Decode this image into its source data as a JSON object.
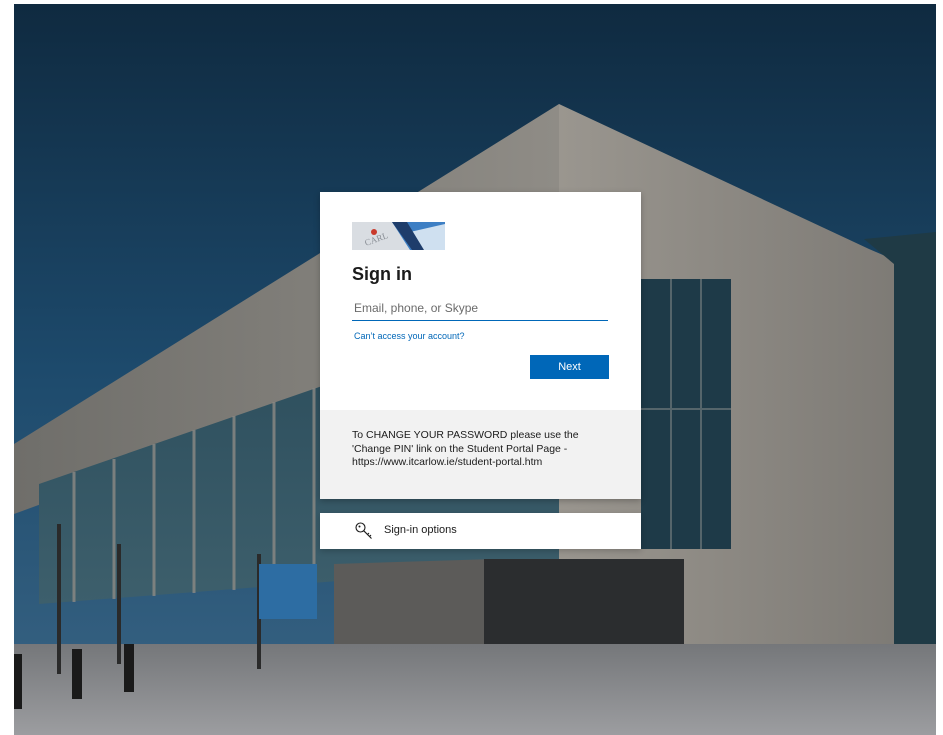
{
  "colors": {
    "accent": "#0067b8",
    "card_bg": "#ffffff",
    "notice_bg": "#f2f2f2",
    "text": "#1b1b1b"
  },
  "background": {
    "icon": "campus-building-photo"
  },
  "card": {
    "logo_icon": "itcarlow-logo",
    "title": "Sign in",
    "email_placeholder": "Email, phone, or Skype",
    "email_value": "",
    "cant_access_link": "Can’t access your account?",
    "next_label": "Next"
  },
  "notice": {
    "line1": "To CHANGE YOUR PASSWORD please use the",
    "line2": "'Change PIN' link on the Student Portal Page -",
    "line3": "https://www.itcarlow.ie/student-portal.htm"
  },
  "options": {
    "icon": "key-icon",
    "label": "Sign-in options"
  }
}
